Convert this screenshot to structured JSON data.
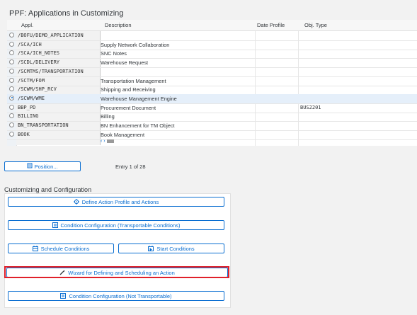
{
  "page": {
    "title": "PPF: Applications in Customizing"
  },
  "table": {
    "columns": {
      "appl": "Appl.",
      "description": "Description",
      "date_profile": "Date Profile",
      "obj_type": "Obj. Type"
    },
    "rows": [
      {
        "appl": "/BOFU/DEMO_APPLICATION",
        "description": "",
        "obj_type": "",
        "selected": false
      },
      {
        "appl": "/SCA/ICH",
        "description": "Supply Network Collaboration",
        "obj_type": "",
        "selected": false
      },
      {
        "appl": "/SCA/ICH_NOTES",
        "description": "SNC Notes",
        "obj_type": "",
        "selected": false
      },
      {
        "appl": "/SCDL/DELIVERY",
        "description": "Warehouse Request",
        "obj_type": "",
        "selected": false
      },
      {
        "appl": "/SCMTMS/TRANSPORTATION",
        "description": "",
        "obj_type": "",
        "selected": false
      },
      {
        "appl": "/SCTM/FOM",
        "description": "Transportation Management",
        "obj_type": "",
        "selected": false
      },
      {
        "appl": "/SCWM/SHP_RCV",
        "description": "Shipping and Receiving",
        "obj_type": "",
        "selected": false
      },
      {
        "appl": "/SCWM/WME",
        "description": "Warehouse Management Engine",
        "obj_type": "",
        "selected": true
      },
      {
        "appl": "BBP_PD",
        "description": "Procurement Document",
        "obj_type": "BUS2201",
        "selected": false
      },
      {
        "appl": "BILLING",
        "description": "Billing",
        "obj_type": "",
        "selected": false
      },
      {
        "appl": "BN_TRANSPORTATION",
        "description": "BN Enhancement for TM Object",
        "obj_type": "",
        "selected": false
      },
      {
        "appl": "BOOK",
        "description": "Book Management",
        "obj_type": "",
        "selected": false
      }
    ],
    "hscroll_arrows": "‹ ›"
  },
  "position": {
    "button_label": "Position...",
    "entry_text": "Entry 1 of 28"
  },
  "config": {
    "section_title": "Customizing and Configuration",
    "buttons": {
      "define_action_profile": "Define Action Profile and Actions",
      "condition_config_transportable": "Condition Configuration (Transportable Conditions)",
      "schedule_conditions": "Schedule Conditions",
      "start_conditions": "Start Conditions",
      "wizard": "Wizard for Defining and Scheduling an Action",
      "condition_config_not_transportable": "Condition Configuration (Not Transportable)"
    }
  },
  "colors": {
    "accent": "#0a6ed1",
    "highlight": "#e0202a",
    "selected_row": "#e5effa"
  },
  "icons": {
    "position": "position-icon",
    "define_action_profile": "action-profile-icon",
    "condition_config_transportable": "condition-config-icon",
    "schedule_conditions": "schedule-icon",
    "start_conditions": "start-conditions-icon",
    "wizard": "wand-icon",
    "condition_config_not_transportable": "condition-config-icon"
  }
}
